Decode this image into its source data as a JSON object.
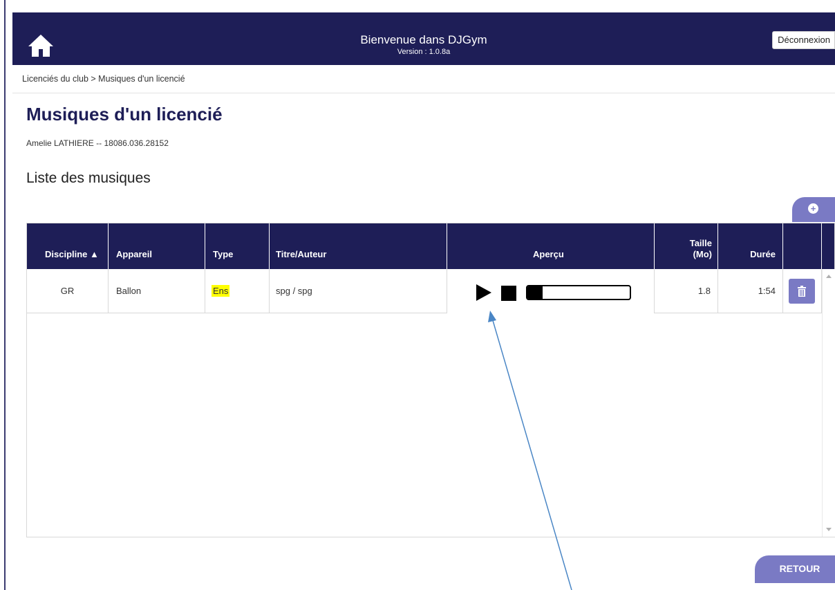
{
  "header": {
    "title": "Bienvenue dans DJGym",
    "version": "Version : 1.0.8a",
    "logout_label": "Déconnexion",
    "home_icon": "home-icon"
  },
  "breadcrumb": {
    "item1": "Licenciés du club",
    "item2": "> Musiques d'un licencié"
  },
  "page": {
    "title": "Musiques d'un licencié",
    "member": "Amelie LATHIERE -- 18086.036.28152",
    "section_title": "Liste des musiques"
  },
  "table": {
    "columns": [
      "Discipline ▲",
      "Appareil",
      "Type",
      "Titre/Auteur",
      "Aperçu",
      "Taille\n(Mo)",
      "Durée"
    ],
    "col_taille_line1": "Taille",
    "col_taille_line2": "(Mo)",
    "rows": [
      {
        "discipline": "GR",
        "appareil": "Ballon",
        "type": "Ens",
        "titre": "spg / spg",
        "taille": "1.8",
        "duree": "1:54",
        "progress": 0.15
      }
    ]
  },
  "buttons": {
    "back_label": "RETOUR",
    "add_icon": "plus-circle-icon",
    "delete_icon": "trash-icon"
  },
  "colors": {
    "header_bg": "#1e1e57",
    "accent": "#7a7ac4",
    "highlight": "#ffff00",
    "annotation_arrow": "#4a86c5"
  }
}
